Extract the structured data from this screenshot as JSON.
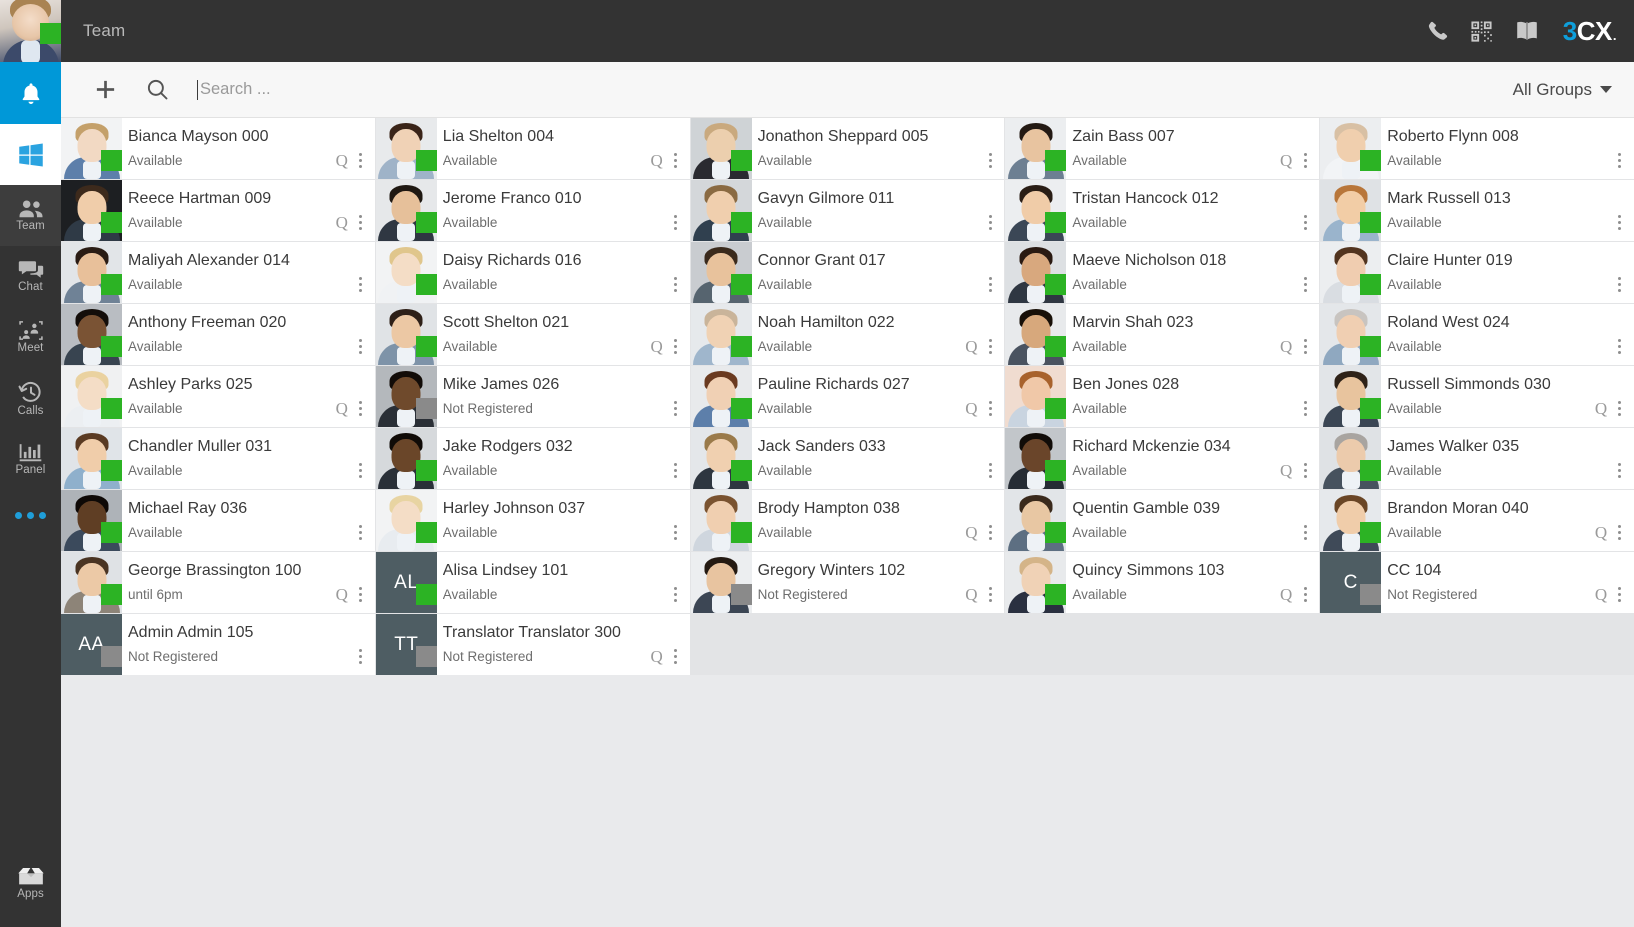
{
  "rail": {
    "profile": {
      "name": "my-avatar",
      "presence": "Available"
    },
    "items": [
      {
        "id": "notifications",
        "label": "",
        "icon": "bell-icon",
        "state": "highlight"
      },
      {
        "id": "windows",
        "label": "",
        "icon": "windows-icon",
        "state": "white"
      },
      {
        "id": "team",
        "label": "Team",
        "icon": "team-icon",
        "state": "active"
      },
      {
        "id": "chat",
        "label": "Chat",
        "icon": "chat-icon",
        "state": ""
      },
      {
        "id": "meet",
        "label": "Meet",
        "icon": "meet-icon",
        "state": ""
      },
      {
        "id": "calls",
        "label": "Calls",
        "icon": "calls-icon",
        "state": ""
      },
      {
        "id": "panel",
        "label": "Panel",
        "icon": "panel-icon",
        "state": ""
      }
    ],
    "more_label": "more-options",
    "apps": {
      "label": "Apps",
      "icon": "apps-icon"
    }
  },
  "topbar": {
    "title": "Team",
    "icons": [
      "phone-icon",
      "qr-code-icon",
      "directory-book-icon"
    ],
    "brand": {
      "part1": "3",
      "part2": "CX",
      "dot": "."
    }
  },
  "toolbar": {
    "add_label": "add-contact",
    "search_label": "search",
    "search": {
      "value": "",
      "placeholder": "Search ..."
    },
    "groups": {
      "label": "All Groups"
    }
  },
  "colors": {
    "accent": "#0098d8",
    "available": "#2cb324",
    "not_registered": "#8a8a8a",
    "rail_bg": "#333333",
    "topbar_bg": "#333333",
    "toolbar_bg": "#f7f7f7",
    "card_bg": "#ffffff",
    "grid_bg": "#e9eaec",
    "initials_bg": "#4e5d63",
    "brand_blue": "#0e9fdb"
  },
  "contacts": [
    {
      "name": "Bianca Mayson 000",
      "status": "Available",
      "presence": "available",
      "q": true,
      "avatar": "photo",
      "skin": "#f2d9c3",
      "hair": "#c4a06a",
      "body": "#5d7faa",
      "bg": "#f2f3f4"
    },
    {
      "name": "Lia Shelton 004",
      "status": "Available",
      "presence": "available",
      "q": true,
      "avatar": "photo",
      "skin": "#f0d2b6",
      "hair": "#3a2418",
      "body": "#9fb3c8",
      "bg": "#e8eaec"
    },
    {
      "name": "Jonathon Sheppard 005",
      "status": "Available",
      "presence": "available",
      "q": false,
      "avatar": "photo",
      "skin": "#eccfae",
      "hair": "#c9a97e",
      "body": "#2a2a30",
      "bg": "#cfd3d6"
    },
    {
      "name": "Zain Bass 007",
      "status": "Available",
      "presence": "available",
      "q": true,
      "avatar": "photo",
      "skin": "#e8c4a0",
      "hair": "#241a14",
      "body": "#6d7f92",
      "bg": "#eceef0"
    },
    {
      "name": "Roberto Flynn 008",
      "status": "Available",
      "presence": "available",
      "q": false,
      "avatar": "photo",
      "skin": "#f0cfae",
      "hair": "#d8c0a4",
      "body": "#f2f4f6",
      "bg": "#eceef0"
    },
    {
      "name": "Reece Hartman 009",
      "status": "Available",
      "presence": "available",
      "q": true,
      "avatar": "photo",
      "skin": "#f0cdaa",
      "hair": "#3d2a1c",
      "body": "#2f3a46",
      "bg": "#1d1f22"
    },
    {
      "name": "Jerome Franco 010",
      "status": "Available",
      "presence": "available",
      "q": false,
      "avatar": "photo",
      "skin": "#e6c09a",
      "hair": "#1f1812",
      "body": "#2f3742",
      "bg": "#e6e8ea"
    },
    {
      "name": "Gavyn Gilmore 011",
      "status": "Available",
      "presence": "available",
      "q": false,
      "avatar": "photo",
      "skin": "#f0cfae",
      "hair": "#8a6a42",
      "body": "#30404f",
      "bg": "#d4d7da"
    },
    {
      "name": "Tristan Hancock 012",
      "status": "Available",
      "presence": "available",
      "q": false,
      "avatar": "photo",
      "skin": "#f0cca8",
      "hair": "#2a1e16",
      "body": "#3b4756",
      "bg": "#eceef0"
    },
    {
      "name": "Mark Russell 013",
      "status": "Available",
      "presence": "available",
      "q": false,
      "avatar": "photo",
      "skin": "#f2cda6",
      "hair": "#b8763a",
      "body": "#9ab4cc",
      "bg": "#dfe2e5"
    },
    {
      "name": "Maliyah Alexander 014",
      "status": "Available",
      "presence": "available",
      "q": false,
      "avatar": "photo",
      "skin": "#e8c09a",
      "hair": "#2a1c14",
      "body": "#6f8296",
      "bg": "#e2e5e8"
    },
    {
      "name": "Daisy Richards 016",
      "status": "Available",
      "presence": "available",
      "q": false,
      "avatar": "photo",
      "skin": "#f4ddc6",
      "hair": "#e0c68c",
      "body": "#f0f2f4",
      "bg": "#f2f3f4"
    },
    {
      "name": "Connor Grant 017",
      "status": "Available",
      "presence": "available",
      "q": false,
      "avatar": "photo",
      "skin": "#e8c29c",
      "hair": "#3a2a1c",
      "body": "#56646f",
      "bg": "#c9ccd0"
    },
    {
      "name": "Maeve Nicholson 018",
      "status": "Available",
      "presence": "available",
      "q": false,
      "avatar": "photo",
      "skin": "#d8a87e",
      "hair": "#2a1a12",
      "body": "#2f3742",
      "bg": "#dde0e3"
    },
    {
      "name": "Claire Hunter 019",
      "status": "Available",
      "presence": "available",
      "q": false,
      "avatar": "photo",
      "skin": "#f0cdb0",
      "hair": "#52341f",
      "body": "#d9dde2",
      "bg": "#eceef0"
    },
    {
      "name": "Anthony Freeman 020",
      "status": "Available",
      "presence": "available",
      "q": false,
      "avatar": "photo",
      "skin": "#7a5334",
      "hair": "#140e0a",
      "body": "#384450",
      "bg": "#b9bdc2"
    },
    {
      "name": "Scott Shelton 021",
      "status": "Available",
      "presence": "available",
      "q": true,
      "avatar": "photo",
      "skin": "#ecc8a4",
      "hair": "#2e2018",
      "body": "#7e93a8",
      "bg": "#e0e3e6"
    },
    {
      "name": "Noah Hamilton 022",
      "status": "Available",
      "presence": "available",
      "q": true,
      "avatar": "photo",
      "skin": "#f0d2b4",
      "hair": "#c9b49a",
      "body": "#9fb6cc",
      "bg": "#e6e9ec"
    },
    {
      "name": "Marvin Shah 023",
      "status": "Available",
      "presence": "available",
      "q": true,
      "avatar": "photo",
      "skin": "#d7a87c",
      "hair": "#181008",
      "body": "#4a5360",
      "bg": "#e8eaec"
    },
    {
      "name": "Roland West 024",
      "status": "Available",
      "presence": "available",
      "q": false,
      "avatar": "photo",
      "skin": "#f0cfb2",
      "hair": "#c8c4c0",
      "body": "#8fa8c0",
      "bg": "#e4e7ea"
    },
    {
      "name": "Ashley Parks 025",
      "status": "Available",
      "presence": "available",
      "q": true,
      "avatar": "photo",
      "skin": "#f4ddc6",
      "hair": "#ead2a0",
      "body": "#eceff2",
      "bg": "#f0f1f2"
    },
    {
      "name": "Mike James 026",
      "status": "Not Registered",
      "presence": "notreg",
      "q": false,
      "avatar": "photo",
      "skin": "#6f4a2c",
      "hair": "#120c08",
      "body": "#2a2f36",
      "bg": "#b4b8bc"
    },
    {
      "name": "Pauline Richards 027",
      "status": "Available",
      "presence": "available",
      "q": true,
      "avatar": "photo",
      "skin": "#f0d0b4",
      "hair": "#6a3a20",
      "body": "#5d7faa",
      "bg": "#e8eaec"
    },
    {
      "name": "Ben Jones 028",
      "status": "Available",
      "presence": "available",
      "q": false,
      "avatar": "photo",
      "skin": "#f0c8a8",
      "hair": "#a8622c",
      "body": "#c9d4e0",
      "bg": "#f0dcd0"
    },
    {
      "name": "Russell Simmonds 030",
      "status": "Available",
      "presence": "available",
      "q": true,
      "avatar": "photo",
      "skin": "#e8c49e",
      "hair": "#2e2218",
      "body": "#3b4654",
      "bg": "#e2e5e8"
    },
    {
      "name": "Chandler Muller 031",
      "status": "Available",
      "presence": "available",
      "q": false,
      "avatar": "photo",
      "skin": "#f0cdaa",
      "hair": "#5a3a22",
      "body": "#8fb0cc",
      "bg": "#e0e4e8"
    },
    {
      "name": "Jake Rodgers 032",
      "status": "Available",
      "presence": "available",
      "q": false,
      "avatar": "photo",
      "skin": "#6a4629",
      "hair": "#100b07",
      "body": "#2a3038",
      "bg": "#d6d9dc"
    },
    {
      "name": "Jack Sanders 033",
      "status": "Available",
      "presence": "available",
      "q": false,
      "avatar": "photo",
      "skin": "#f0d0b0",
      "hair": "#9a7a4a",
      "body": "#2e3640",
      "bg": "#e4e7ea"
    },
    {
      "name": "Richard Mckenzie 034",
      "status": "Available",
      "presence": "available",
      "q": true,
      "avatar": "photo",
      "skin": "#6a452a",
      "hair": "#110c08",
      "body": "#262c34",
      "bg": "#c2c6ca"
    },
    {
      "name": "James Walker 035",
      "status": "Available",
      "presence": "available",
      "q": false,
      "avatar": "photo",
      "skin": "#eccbac",
      "hair": "#a8a4a0",
      "body": "#47525e",
      "bg": "#dfe2e5"
    },
    {
      "name": "Michael Ray 036",
      "status": "Available",
      "presence": "available",
      "q": false,
      "avatar": "photo",
      "skin": "#5f3e24",
      "hair": "#0e0906",
      "body": "#3b4a5c",
      "bg": "#aeb3b8"
    },
    {
      "name": "Harley Johnson 037",
      "status": "Available",
      "presence": "available",
      "q": false,
      "avatar": "photo",
      "skin": "#f4ddc6",
      "hair": "#e8d4a2",
      "body": "#e8ecf0",
      "bg": "#f2f3f4"
    },
    {
      "name": "Brody Hampton 038",
      "status": "Available",
      "presence": "available",
      "q": true,
      "avatar": "photo",
      "skin": "#f0cfb0",
      "hair": "#7a5330",
      "body": "#cfd6de",
      "bg": "#e8eaec"
    },
    {
      "name": "Quentin Gamble 039",
      "status": "Available",
      "presence": "available",
      "q": false,
      "avatar": "photo",
      "skin": "#e8c7a3",
      "hair": "#3a2a1c",
      "body": "#5d6f82",
      "bg": "#e2e5e8"
    },
    {
      "name": "Brandon Moran 040",
      "status": "Available",
      "presence": "available",
      "q": true,
      "avatar": "photo",
      "skin": "#f0cdaa",
      "hair": "#6a4626",
      "body": "#3f4a58",
      "bg": "#e6e9ec"
    },
    {
      "name": "George Brassington 100",
      "status": "until 6pm",
      "presence": "available",
      "q": true,
      "avatar": "photo",
      "skin": "#ecc9a6",
      "hair": "#4a3422",
      "body": "#8d8478",
      "bg": "#dfe2e5"
    },
    {
      "name": "Alisa Lindsey 101",
      "status": "Available",
      "presence": "available",
      "q": false,
      "avatar": "initials",
      "initials": "AL"
    },
    {
      "name": "Gregory Winters 102",
      "status": "Not Registered",
      "presence": "notreg",
      "q": true,
      "avatar": "photo",
      "skin": "#e8c4a0",
      "hair": "#241a12",
      "body": "#3c4654",
      "bg": "#eceef0"
    },
    {
      "name": "Quincy Simmons 103",
      "status": "Available",
      "presence": "available",
      "q": true,
      "avatar": "photo",
      "skin": "#f0d2b6",
      "hair": "#d4b488",
      "body": "#2a3040",
      "bg": "#e8eaec"
    },
    {
      "name": "CC 104",
      "status": "Not Registered",
      "presence": "notreg",
      "q": true,
      "avatar": "initials",
      "initials": "C"
    },
    {
      "name": "Admin Admin 105",
      "status": "Not Registered",
      "presence": "notreg",
      "q": false,
      "avatar": "initials",
      "initials": "AA"
    },
    {
      "name": "Translator Translator 300",
      "status": "Not Registered",
      "presence": "notreg",
      "q": true,
      "avatar": "initials",
      "initials": "TT"
    }
  ]
}
